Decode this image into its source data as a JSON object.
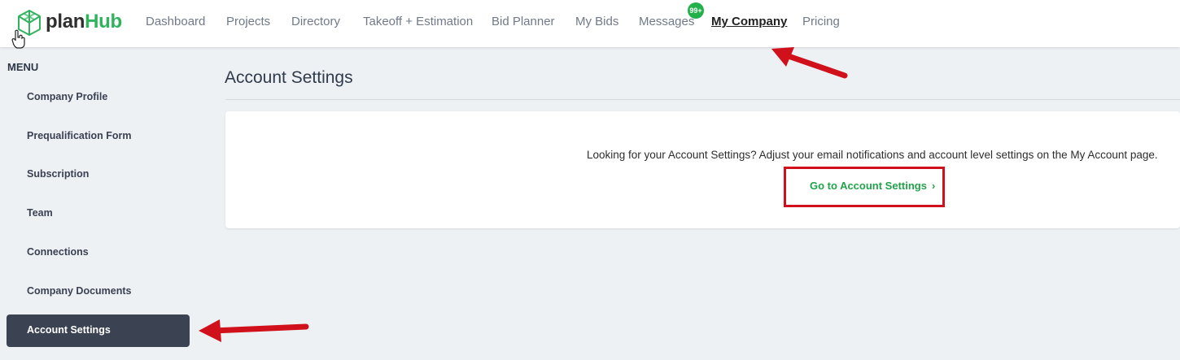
{
  "brand": {
    "plan": "plan",
    "hub": "Hub"
  },
  "nav": {
    "items": [
      {
        "label": "Dashboard"
      },
      {
        "label": "Projects"
      },
      {
        "label": "Directory"
      },
      {
        "label": "Takeoff + Estimation"
      },
      {
        "label": "Bid Planner"
      },
      {
        "label": "My Bids"
      },
      {
        "label": "Messages"
      },
      {
        "label": "My Company"
      },
      {
        "label": "Pricing"
      }
    ],
    "messages_badge": "99+",
    "active": "My Company"
  },
  "sidebar": {
    "title": "MENU",
    "items": [
      {
        "label": "Company Profile"
      },
      {
        "label": "Prequalification Form"
      },
      {
        "label": "Subscription"
      },
      {
        "label": "Team"
      },
      {
        "label": "Connections"
      },
      {
        "label": "Company Documents"
      },
      {
        "label": "Account Settings"
      }
    ],
    "active": "Account Settings"
  },
  "main": {
    "title": "Account Settings",
    "message": "Looking for your Account Settings? Adjust your email notifications and account level settings on the My Account page.",
    "link_label": "Go to Account Settings",
    "link_chevron": "›"
  },
  "colors": {
    "brand_green": "#2fb35d",
    "active_sidebar": "#3b4251",
    "annotation_red": "#d0111b",
    "background": "#eef1f4"
  }
}
